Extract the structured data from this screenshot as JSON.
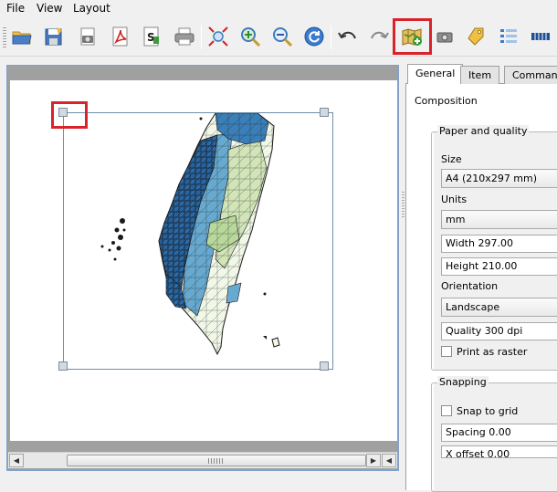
{
  "menu": {
    "file": "File",
    "view": "View",
    "layout": "Layout"
  },
  "toolbar": {
    "buttons": [
      {
        "icon": "open-folder-icon"
      },
      {
        "icon": "save-icon"
      },
      {
        "icon": "export-image-icon"
      },
      {
        "icon": "export-pdf-icon"
      },
      {
        "icon": "export-svg-icon"
      },
      {
        "icon": "print-icon"
      },
      {
        "icon": "zoom-full-icon"
      },
      {
        "icon": "zoom-in-icon"
      },
      {
        "icon": "zoom-out-icon"
      },
      {
        "icon": "refresh-icon"
      },
      {
        "icon": "undo-icon"
      },
      {
        "icon": "redo-icon"
      },
      {
        "icon": "add-map-icon"
      },
      {
        "icon": "add-image-icon"
      },
      {
        "icon": "add-label-icon"
      },
      {
        "icon": "add-legend-icon"
      },
      {
        "icon": "add-scalebar-icon"
      }
    ],
    "highlight_color": "#d9232a"
  },
  "panel": {
    "tabs": [
      "General",
      "Item",
      "Command"
    ],
    "section": "Composition",
    "paper": {
      "title": "Paper and quality",
      "size_label": "Size",
      "size_value": "A4 (210x297 mm)",
      "units_label": "Units",
      "units_value": "mm",
      "width": "Width 297.00",
      "height": "Height 210.00",
      "orientation_label": "Orientation",
      "orientation_value": "Landscape",
      "quality": "Quality 300 dpi",
      "print_raster": "Print as raster"
    },
    "snapping": {
      "title": "Snapping",
      "snap_to_grid": "Snap to grid",
      "spacing": "Spacing 0.00",
      "x_offset": "X offset 0.00"
    }
  },
  "map_colors": {
    "dark": "#2166ac",
    "mid": "#67a9cf",
    "light": "#d1e5b8",
    "pale": "#f2f8e8",
    "outline": "#1a1a1a"
  }
}
